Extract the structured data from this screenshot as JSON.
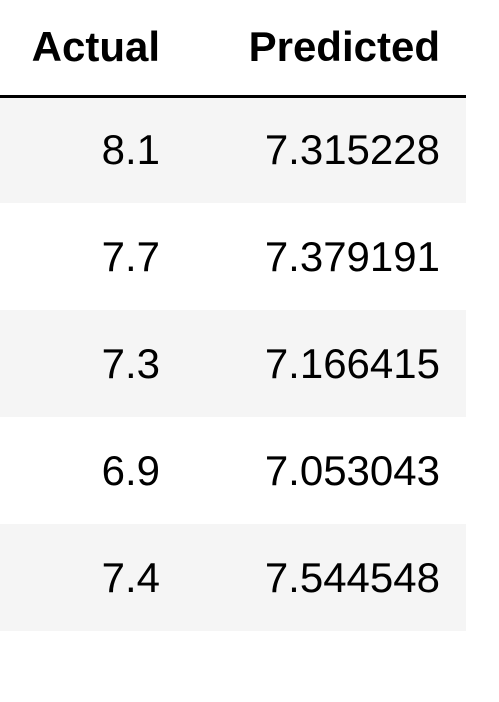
{
  "table": {
    "columns": [
      "Actual",
      "Predicted"
    ],
    "rows": [
      {
        "actual": "8.1",
        "predicted": "7.315228"
      },
      {
        "actual": "7.7",
        "predicted": "7.379191"
      },
      {
        "actual": "7.3",
        "predicted": "7.166415"
      },
      {
        "actual": "6.9",
        "predicted": "7.053043"
      },
      {
        "actual": "7.4",
        "predicted": "7.544548"
      }
    ]
  },
  "colors": {
    "stripe": "#f5f5f5",
    "background": "#ffffff",
    "text": "#000000",
    "header_rule": "#000000"
  }
}
